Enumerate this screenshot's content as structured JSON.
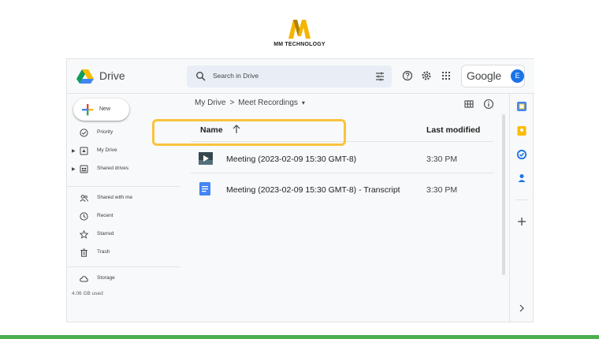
{
  "brand": {
    "logo_text": "MM TECHNOLOGY"
  },
  "app": {
    "name": "Drive",
    "account_initial": "E",
    "account_word": "Google"
  },
  "search": {
    "placeholder": "Search in Drive"
  },
  "sidebar": {
    "new_label": "New",
    "items": [
      {
        "label": "Priority",
        "icon": "priority-icon"
      },
      {
        "label": "My Drive",
        "icon": "my-drive-icon",
        "expandable": true
      },
      {
        "label": "Shared drives",
        "icon": "shared-drives-icon",
        "expandable": true
      },
      {
        "label": "Shared with me",
        "icon": "shared-with-me-icon"
      },
      {
        "label": "Recent",
        "icon": "clock-icon"
      },
      {
        "label": "Starred",
        "icon": "star-icon"
      },
      {
        "label": "Trash",
        "icon": "trash-icon"
      }
    ],
    "storage_label": "Storage",
    "storage_used": "4.06 GB used"
  },
  "breadcrumb": {
    "root": "My Drive",
    "sep": ">",
    "current": "Meet Recordings",
    "caret": "▾"
  },
  "table": {
    "col_name": "Name",
    "col_modified": "Last modified",
    "rows": [
      {
        "name": "Meeting (2023-02-09 15:30 GMT-8)",
        "modified": "3:30 PM",
        "type": "video"
      },
      {
        "name": "Meeting (2023-02-09 15:30 GMT-8) - Transcript",
        "modified": "3:30 PM",
        "type": "doc"
      }
    ]
  },
  "colors": {
    "accent": "#1a73e8",
    "highlight": "#f9c33c",
    "bottom_bar": "#4caf50"
  }
}
